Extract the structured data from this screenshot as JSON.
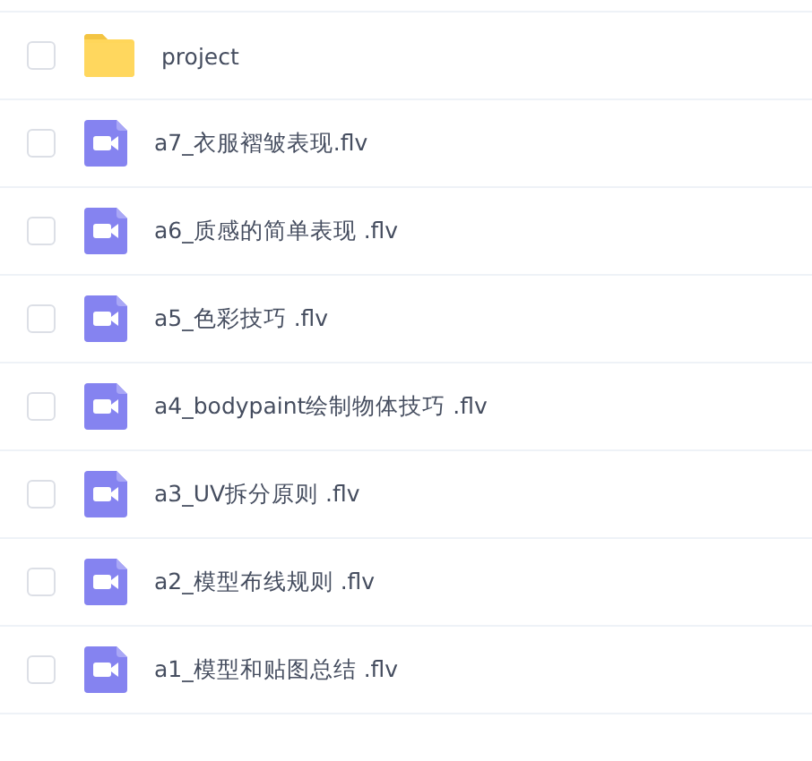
{
  "files": [
    {
      "name": "project",
      "kind": "folder",
      "checked": false
    },
    {
      "name": "a7_衣服褶皱表现.flv",
      "kind": "video",
      "checked": false
    },
    {
      "name": "a6_质感的简单表现 .flv",
      "kind": "video",
      "checked": false
    },
    {
      "name": "a5_色彩技巧 .flv",
      "kind": "video",
      "checked": false
    },
    {
      "name": "a4_bodypaint绘制物体技巧 .flv",
      "kind": "video",
      "checked": false
    },
    {
      "name": "a3_UV拆分原则 .flv",
      "kind": "video",
      "checked": false
    },
    {
      "name": "a2_模型布线规则 .flv",
      "kind": "video",
      "checked": false
    },
    {
      "name": "a1_模型和贴图总结 .flv",
      "kind": "video",
      "checked": false
    }
  ]
}
